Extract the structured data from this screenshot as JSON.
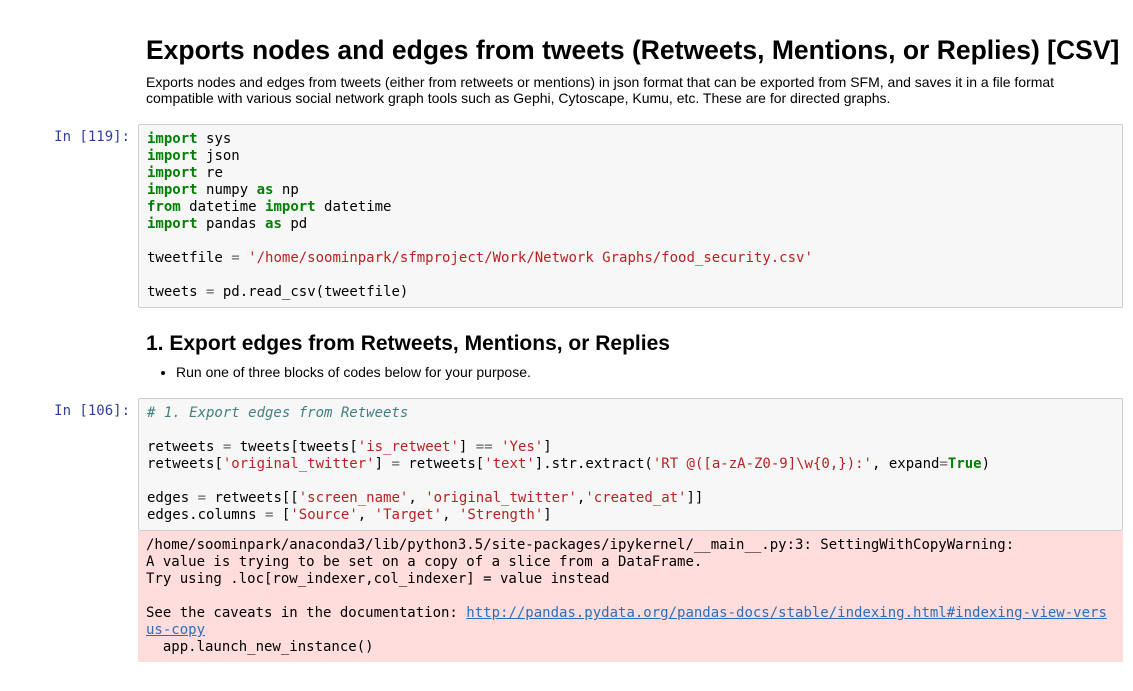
{
  "title": "Exports nodes and edges from tweets (Retweets, Mentions, or Replies) [CSV]",
  "description": "Exports nodes and edges from tweets (either from retweets or mentions) in json format that can be exported from SFM, and saves it in a file format compatible with various social network graph tools such as Gephi, Cytoscape, Kumu, etc. These are for directed graphs.",
  "cell1": {
    "prompt": "In [119]:",
    "code_html": "<span class='k'>import</span> <span class='nn'>sys</span>\n<span class='k'>import</span> <span class='nn'>json</span>\n<span class='k'>import</span> <span class='nn'>re</span>\n<span class='k'>import</span> <span class='nn'>numpy</span> <span class='k'>as</span> <span class='nn'>np</span>\n<span class='k'>from</span> <span class='nn'>datetime</span> <span class='k'>import</span> <span class='nn'>datetime</span>\n<span class='k'>import</span> <span class='nn'>pandas</span> <span class='k'>as</span> <span class='nn'>pd</span>\n\ntweetfile <span class='o'>=</span> <span class='s'>'/home/soominpark/sfmproject/Work/Network Graphs/food_security.csv'</span>\n\ntweets <span class='o'>=</span> pd<span class='p'>.</span>read_csv<span class='p'>(</span>tweetfile<span class='p'>)</span>"
  },
  "section1": {
    "heading": "1. Export edges from Retweets, Mentions, or Replies",
    "bullet": "Run one of three blocks of codes below for your purpose."
  },
  "cell2": {
    "prompt": "In [106]:",
    "code_html": "<span class='c'># 1. Export edges from Retweets</span>\n\nretweets <span class='o'>=</span> tweets<span class='p'>[</span>tweets<span class='p'>[</span><span class='s'>'is_retweet'</span><span class='p'>]</span> <span class='o'>==</span> <span class='s'>'Yes'</span><span class='p'>]</span>\nretweets<span class='p'>[</span><span class='s'>'original_twitter'</span><span class='p'>]</span> <span class='o'>=</span> retweets<span class='p'>[</span><span class='s'>'text'</span><span class='p'>]</span><span class='p'>.</span>str<span class='p'>.</span>extract<span class='p'>(</span><span class='s'>'RT @([a-zA-Z0-9]\\w{0,}):'</span><span class='p'>,</span> expand<span class='o'>=</span><span class='kc'>True</span><span class='p'>)</span>\n\nedges <span class='o'>=</span> retweets<span class='p'>[[</span><span class='s'>'screen_name'</span><span class='p'>,</span> <span class='s'>'original_twitter'</span><span class='p'>,</span><span class='s'>'created_at'</span><span class='p'>]]</span>\nedges<span class='p'>.</span>columns <span class='o'>=</span> <span class='p'>[</span><span class='s'>'Source'</span><span class='p'>,</span> <span class='s'>'Target'</span><span class='p'>,</span> <span class='s'>'Strength'</span><span class='p'>]</span>",
    "stderr_pre": "/home/soominpark/anaconda3/lib/python3.5/site-packages/ipykernel/__main__.py:3: SettingWithCopyWarning: \nA value is trying to be set on a copy of a slice from a DataFrame.\nTry using .loc[row_indexer,col_indexer] = value instead\n\nSee the caveats in the documentation: ",
    "stderr_link": "http://pandas.pydata.org/pandas-docs/stable/indexing.html#indexing-view-versus-copy",
    "stderr_post": "\n  app.launch_new_instance()"
  }
}
